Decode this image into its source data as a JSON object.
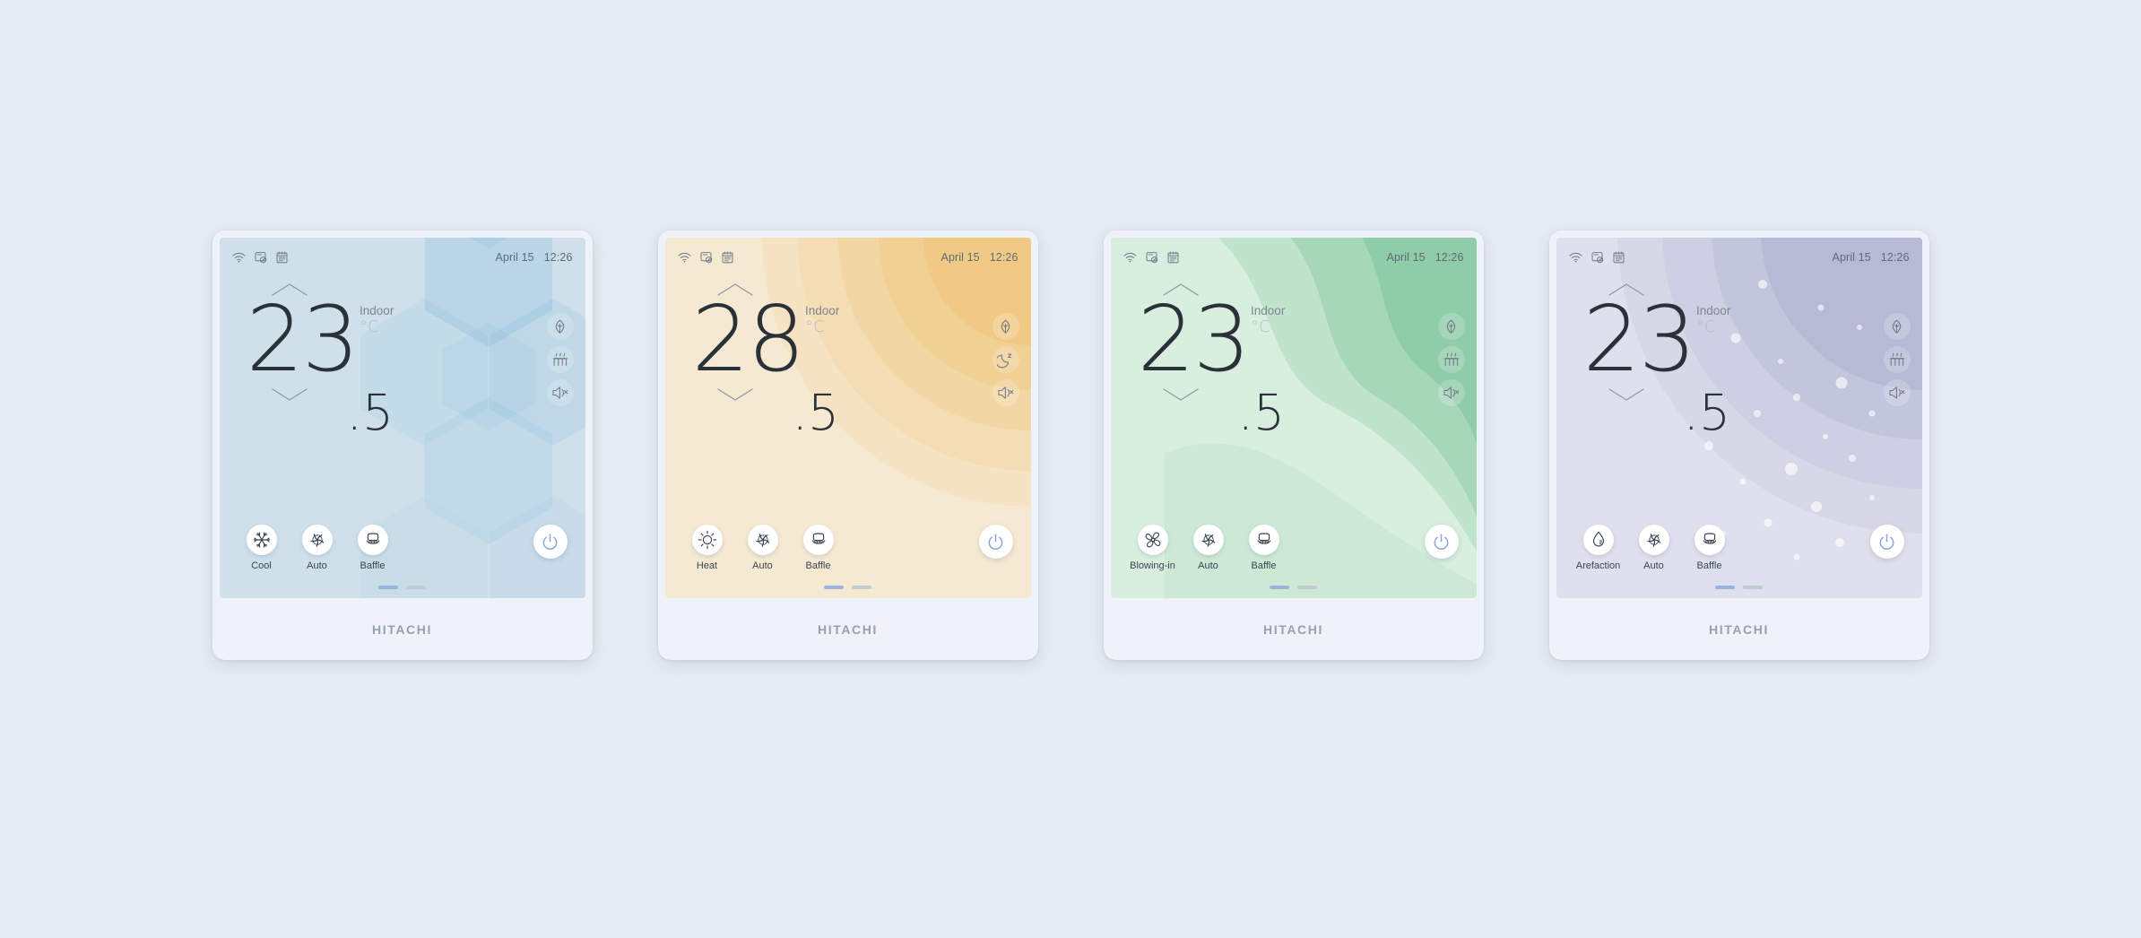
{
  "page": {
    "background_color": "#e6ebf2",
    "brand": "HITACHI",
    "card_background": "#f0f2f9"
  },
  "shared": {
    "status_icons": [
      "wifi-icon",
      "remote-lock-icon",
      "schedule-icon"
    ],
    "date": "April 15",
    "time": "12:26",
    "indoor_label": "Indoor",
    "unit_label": "°C",
    "fan_label": "Auto",
    "swing_label": "Baffle",
    "page_dots": [
      true,
      false
    ]
  },
  "panels": [
    {
      "id": "cool",
      "theme_color": "#cfe0ea",
      "accent_color": "#8cc0de",
      "bg_pattern": "hexagons",
      "date": "April 15",
      "time": "12:26",
      "temp_int": "23",
      "temp_dec": ".5",
      "indoor_label": "Indoor",
      "unit_label": "°C",
      "mode_label": "Cool",
      "mode_icon": "snowflake-icon",
      "fan_label": "Auto",
      "fan_icon": "fan-swirl-icon",
      "swing_label": "Baffle",
      "swing_icon": "baffle-vent-icon",
      "side_icons": [
        "eco-leaf-icon",
        "heater-coil-icon",
        "mute-speaker-icon"
      ],
      "power_color": "#8aa6d9"
    },
    {
      "id": "heat",
      "theme_color": "#f5e6cb",
      "accent_color": "#f0c269",
      "bg_pattern": "sun-rings",
      "date": "April 15",
      "time": "12:26",
      "temp_int": "28",
      "temp_dec": ".5",
      "indoor_label": "Indoor",
      "unit_label": "°C",
      "mode_label": "Heat",
      "mode_icon": "sun-icon",
      "fan_label": "Auto",
      "fan_icon": "fan-swirl-icon",
      "swing_label": "Baffle",
      "swing_icon": "baffle-vent-icon",
      "side_icons": [
        "eco-leaf-icon",
        "sleep-moon-icon",
        "mute-speaker-icon"
      ],
      "power_color": "#8aa6d9"
    },
    {
      "id": "fan",
      "theme_color": "#d4ecd9",
      "accent_color": "#83cb9c",
      "bg_pattern": "waves",
      "date": "April 15",
      "time": "12:26",
      "temp_int": "23",
      "temp_dec": ".5",
      "indoor_label": "Indoor",
      "unit_label": "°C",
      "mode_label": "Blowing-in",
      "mode_icon": "fan-blades-icon",
      "fan_label": "Auto",
      "fan_icon": "fan-swirl-icon",
      "swing_label": "Baffle",
      "swing_icon": "baffle-vent-icon",
      "side_icons": [
        "eco-leaf-icon",
        "heater-coil-icon",
        "mute-speaker-icon"
      ],
      "power_color": "#8aa6d9"
    },
    {
      "id": "dry",
      "theme_color": "#dddeec",
      "accent_color": "#b4b7d4",
      "bg_pattern": "bubbles",
      "date": "April 15",
      "time": "12:26",
      "temp_int": "23",
      "temp_dec": ".5",
      "indoor_label": "Indoor",
      "unit_label": "°C",
      "mode_label": "Arefaction",
      "mode_icon": "water-drop-icon",
      "fan_label": "Auto",
      "fan_icon": "fan-swirl-icon",
      "swing_label": "Baffle",
      "swing_icon": "baffle-vent-icon",
      "side_icons": [
        "eco-leaf-icon",
        "heater-coil-icon",
        "mute-speaker-icon"
      ],
      "power_color": "#8aa6d9"
    }
  ]
}
